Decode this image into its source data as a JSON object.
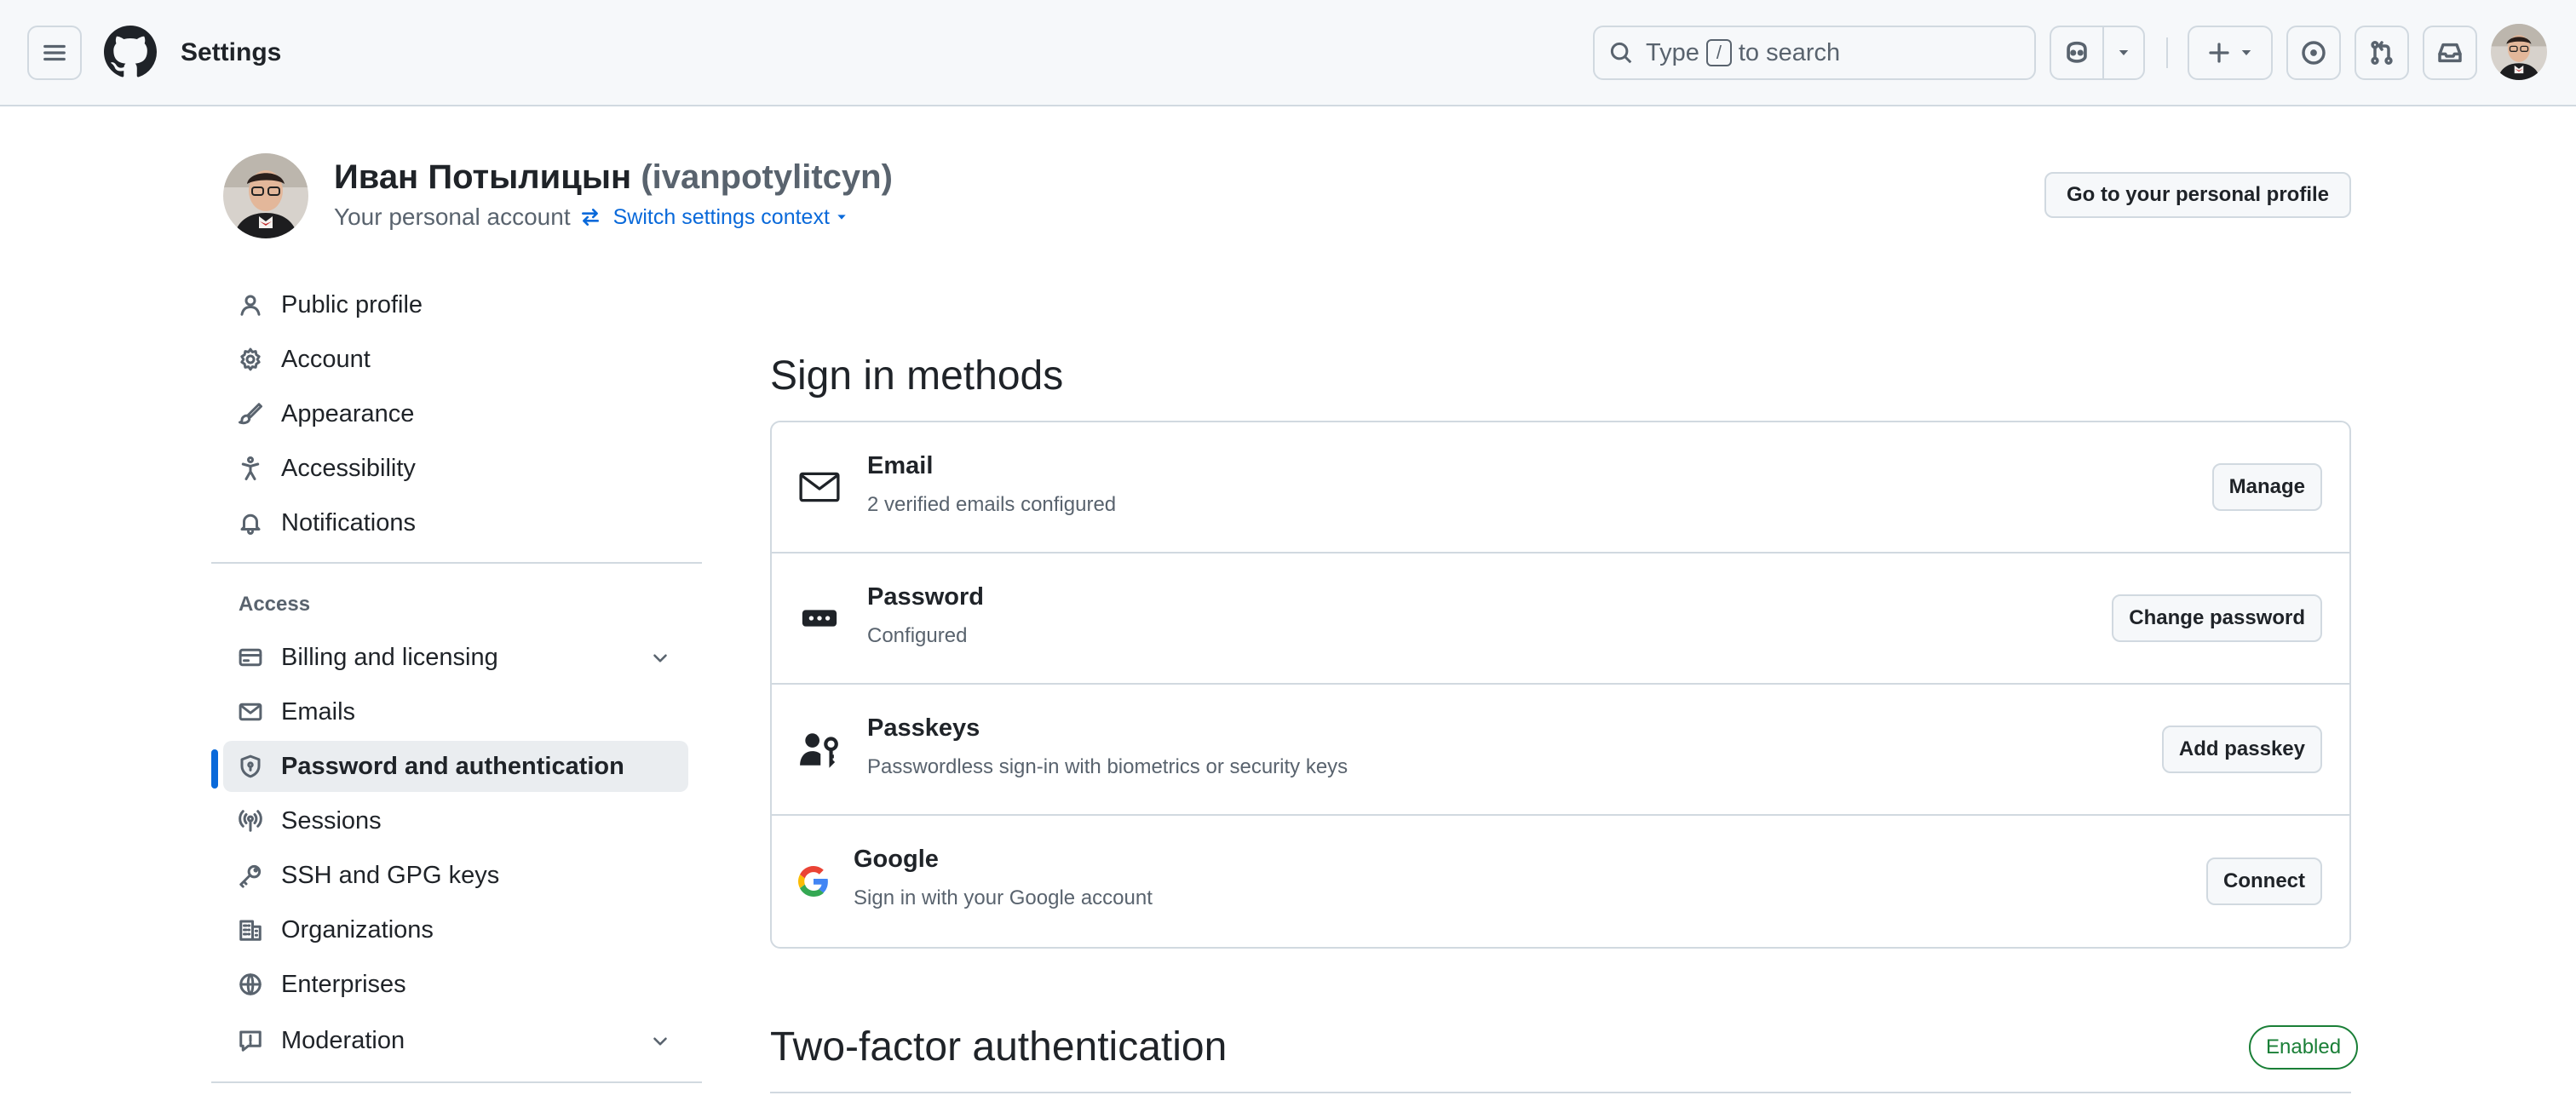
{
  "header": {
    "title": "Settings",
    "search_prefix": "Type",
    "search_key": "/",
    "search_suffix": "to search"
  },
  "profile": {
    "name": "Иван Потылицын",
    "login": "(ivanpotylitcyn)",
    "subtitle": "Your personal account",
    "switch_label": "Switch settings context",
    "profile_button": "Go to your personal profile"
  },
  "sidebar": {
    "items": [
      {
        "label": "Public profile",
        "icon": "person-icon"
      },
      {
        "label": "Account",
        "icon": "gear-icon"
      },
      {
        "label": "Appearance",
        "icon": "paintbrush-icon"
      },
      {
        "label": "Accessibility",
        "icon": "accessibility-icon"
      },
      {
        "label": "Notifications",
        "icon": "bell-icon"
      }
    ],
    "access_label": "Access",
    "access_items": [
      {
        "label": "Billing and licensing",
        "icon": "credit-card-icon",
        "expandable": true
      },
      {
        "label": "Emails",
        "icon": "mail-icon"
      },
      {
        "label": "Password and authentication",
        "icon": "shield-lock-icon",
        "active": true
      },
      {
        "label": "Sessions",
        "icon": "broadcast-icon"
      },
      {
        "label": "SSH and GPG keys",
        "icon": "key-icon"
      },
      {
        "label": "Organizations",
        "icon": "organization-icon"
      },
      {
        "label": "Enterprises",
        "icon": "globe-icon"
      },
      {
        "label": "Moderation",
        "icon": "report-icon",
        "expandable": true
      }
    ]
  },
  "main": {
    "sign_in_title": "Sign in methods",
    "methods": [
      {
        "title": "Email",
        "desc": "2 verified emails configured",
        "button": "Manage",
        "icon": "mail-icon"
      },
      {
        "title": "Password",
        "desc": "Configured",
        "button": "Change password",
        "icon": "password-icon"
      },
      {
        "title": "Passkeys",
        "desc": "Passwordless sign-in with biometrics or security keys",
        "button": "Add passkey",
        "icon": "passkey-icon"
      },
      {
        "title": "Google",
        "desc": "Sign in with your Google account",
        "button": "Connect",
        "icon": "google-icon"
      }
    ],
    "twofa_title": "Two-factor authentication",
    "twofa_badge": "Enabled"
  },
  "colors": {
    "accent": "#0969da",
    "success": "#1a7f37",
    "border": "#d1d9e0",
    "muted": "#59636e"
  }
}
